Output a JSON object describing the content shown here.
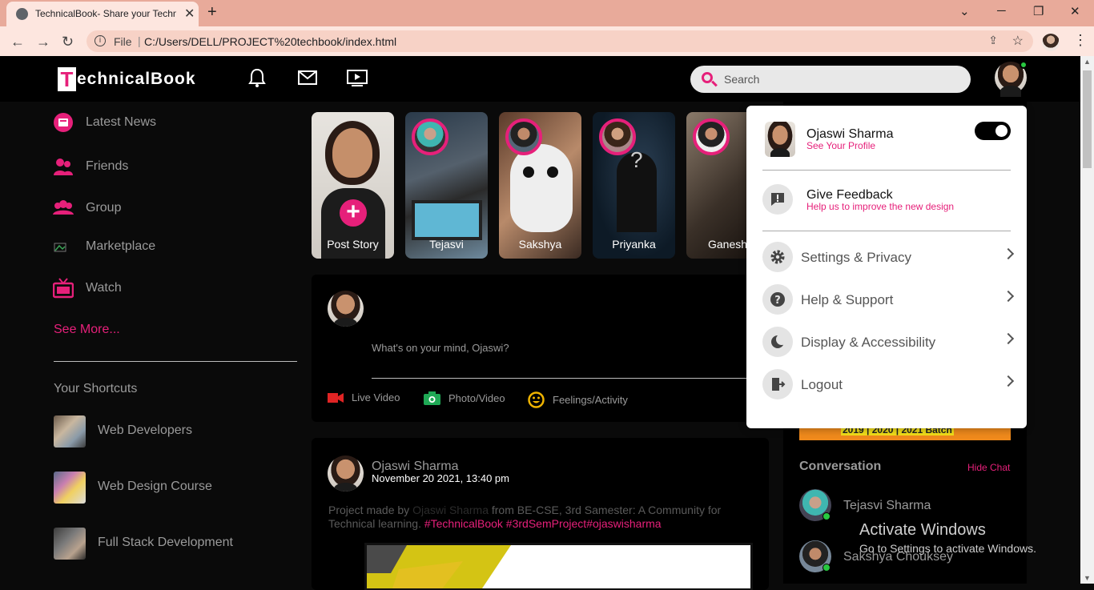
{
  "browser": {
    "tab_title": "TechnicalBook- Share your Technical",
    "tab_close": "✕",
    "new_tab": "+",
    "address_label": "File",
    "url": "C:/Users/DELL/PROJECT%20techbook/index.html"
  },
  "site": {
    "logo_first": "T",
    "logo_rest": "echnicalBook",
    "search_placeholder": "Search"
  },
  "sidebar": {
    "items": [
      {
        "label": "Latest News",
        "icon": "news-icon"
      },
      {
        "label": "Friends",
        "icon": "friends-icon"
      },
      {
        "label": "Group",
        "icon": "group-icon"
      },
      {
        "label": "Marketplace",
        "icon": "marketplace-icon"
      },
      {
        "label": "Watch",
        "icon": "tv-icon"
      }
    ],
    "see_more": "See More...",
    "shortcuts_title": "Your Shortcuts",
    "shortcuts": [
      {
        "label": "Web Developers"
      },
      {
        "label": "Web Design Course"
      },
      {
        "label": "Full Stack Development"
      }
    ]
  },
  "stories": [
    {
      "name": "Post Story"
    },
    {
      "name": "Tejasvi"
    },
    {
      "name": "Sakshya"
    },
    {
      "name": "Priyanka"
    },
    {
      "name": "Ganesh"
    }
  ],
  "create_post": {
    "placeholder": "What's on your mind, Ojaswi?",
    "actions": [
      {
        "label": "Live Video",
        "color": "#e02424"
      },
      {
        "label": "Photo/Video",
        "color": "#1fa855"
      },
      {
        "label": "Feelings/Activity",
        "color": "#f0b400"
      }
    ]
  },
  "post": {
    "author": "Ojaswi Sharma",
    "date": "November 20 2021, 13:40 pm",
    "text_prefix": "Project made by ",
    "text_author": "Ojaswi Sharma",
    "text_middle": " from BE-CSE, 3rd Samester: A Community for Technical learning. ",
    "tags": "#TechnicalBook #3rdSemProject#ojaswisharma"
  },
  "right": {
    "batch_text": "2019 | 2020 | 2021 Batch",
    "conversation_title": "Conversation",
    "hide_chat": "Hide Chat",
    "contacts": [
      {
        "name": "Tejasvi Sharma"
      },
      {
        "name": "Sakshya Chouksey"
      }
    ]
  },
  "dropdown": {
    "name": "Ojaswi Sharma",
    "see_profile": "See Your Profile",
    "feedback_title": "Give Feedback",
    "feedback_sub": "Help us to improve the new design",
    "items": [
      {
        "label": "Settings & Privacy",
        "icon": "gear-icon"
      },
      {
        "label": "Help & Support",
        "icon": "help-icon"
      },
      {
        "label": "Display & Accessibility",
        "icon": "moon-icon"
      },
      {
        "label": "Logout",
        "icon": "logout-icon"
      }
    ]
  },
  "watermark": {
    "title": "Activate Windows",
    "subtitle": "Go to Settings to activate Windows."
  },
  "colors": {
    "accent": "#e6207a",
    "online": "#28c840",
    "banner": "#f08a1c"
  }
}
